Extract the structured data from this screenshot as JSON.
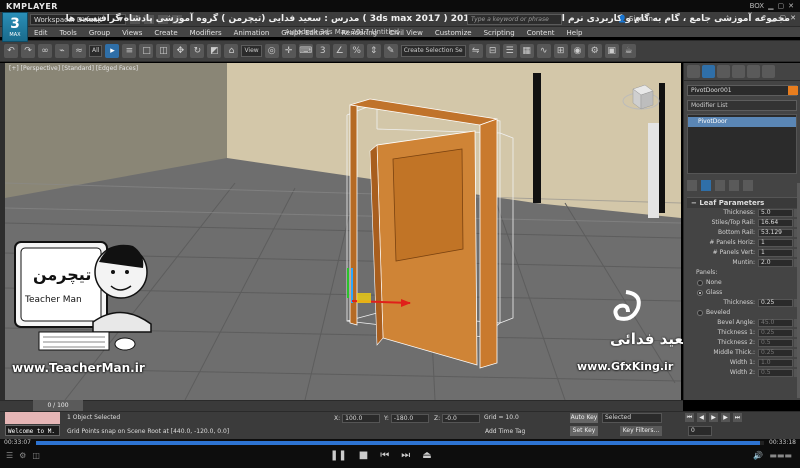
{
  "player": {
    "brand": "KMPLAYER",
    "corner_text": "BOX",
    "time_elapsed": "00:33:07",
    "time_total": "00:33:18",
    "progress": 0.995
  },
  "titlebar": {
    "workspace_label": "Workspace: Default",
    "persian_title": "مجموعه آموزشی جامع ، گام به گام و کاربردی نرم افزار تری دی مکس 2017 ( 3ds max 2017 )  مدرس : سعید فدایی (تیچرمن ) گروه آموزشی پادشاه گرافیست ها",
    "app_title": "Autodesk 3ds Max 2017     Untitled",
    "search_placeholder": "Type a keyword or phrase",
    "signin": "Sign In",
    "max_version_label": "MAX"
  },
  "menu": {
    "items": [
      "Edit",
      "Tools",
      "Group",
      "Views",
      "Create",
      "Modifiers",
      "Animation",
      "Graph Editors",
      "Rendering",
      "Civil View",
      "Customize",
      "Scripting",
      "Content",
      "Help"
    ]
  },
  "toolbar": {
    "filter_select": "All",
    "ref_coord_select": "View",
    "named_selection": "Create Selection Se"
  },
  "viewport": {
    "label": "[+] [Perspective] [Standard] [Edged Faces]"
  },
  "command_panel": {
    "object_name": "PivotDoor001",
    "object_color": "#e87d1e",
    "modifier_list_label": "Modifier List",
    "stack_item": "PivotDoor",
    "rollout_title": "Leaf Parameters",
    "params": [
      {
        "label": "Thickness:",
        "value": "5.0"
      },
      {
        "label": "Stiles/Top Rail:",
        "value": "16.64"
      },
      {
        "label": "Bottom Rail:",
        "value": "53.129"
      },
      {
        "label": "# Panels Horiz:",
        "value": "1"
      },
      {
        "label": "# Panels Vert:",
        "value": "1"
      },
      {
        "label": "Muntin:",
        "value": "2.0"
      }
    ],
    "panels_label": "Panels:",
    "radios": [
      {
        "label": "None",
        "checked": false
      },
      {
        "label": "Glass",
        "checked": true
      }
    ],
    "glass_thickness": {
      "label": "Thickness:",
      "value": "0.25"
    },
    "beveled": {
      "label": "Beveled",
      "checked": false
    },
    "bevel_params": [
      {
        "label": "Bevel Angle:",
        "value": "45.0"
      },
      {
        "label": "Thickness 1:",
        "value": "0.25"
      },
      {
        "label": "Thickness 2:",
        "value": "0.5"
      },
      {
        "label": "Middle Thick.:",
        "value": "0.25"
      },
      {
        "label": "Width 1:",
        "value": "1.0"
      },
      {
        "label": "Width 2:",
        "value": "0.5"
      }
    ]
  },
  "timeline": {
    "slider_label": "0 / 100"
  },
  "status": {
    "maxscript_text": "Welcome to M.",
    "line1": "1 Object Selected",
    "line2": "Grid Points snap on Scene Root at [440.0, -120.0, 0.0]",
    "x_label": "X:",
    "x_value": "100.0",
    "y_label": "Y:",
    "y_value": "-180.0",
    "z_label": "Z:",
    "z_value": "-0.0",
    "grid": "Grid = 10.0",
    "add_time_tag": "Add Time Tag",
    "auto_key": "Auto Key",
    "set_key": "Set Key",
    "selected_dd": "Selected",
    "key_filters": "Key Filters...",
    "frame": "0"
  },
  "watermarks": {
    "teacherman_url": "www.TeacherMan.ir",
    "teacherman_name": "Teacher Man",
    "teacherman_persian": "تیچرمن",
    "gfx_url": "www.GfxKing.ir",
    "gfx_name": "سعید فدائی"
  }
}
